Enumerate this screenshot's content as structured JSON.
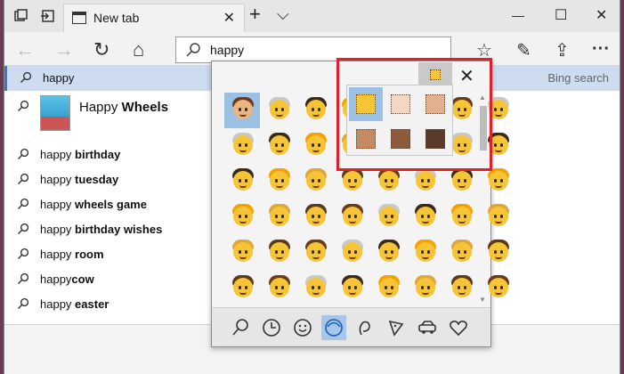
{
  "tab": {
    "title": "New tab",
    "close": "✕",
    "new": "+",
    "menu": "⌵"
  },
  "window_controls": {
    "minimize": "—",
    "maximize": "☐",
    "close": "✕"
  },
  "nav": {
    "back": "←",
    "forward": "→",
    "refresh": "↻",
    "home": "⌂"
  },
  "address": {
    "value": "happy"
  },
  "toolbar_right": {
    "favorite": "☆",
    "pen": "✎",
    "share": "⇪",
    "more": "···"
  },
  "suggestions": {
    "selected": {
      "text": "happy",
      "right": "Bing search"
    },
    "app": {
      "prefix": "Happy ",
      "bold": "Wheels"
    },
    "items": [
      {
        "prefix": "happy ",
        "bold": "birthday"
      },
      {
        "prefix": "happy ",
        "bold": "tuesday"
      },
      {
        "prefix": "happy ",
        "bold": "wheels game"
      },
      {
        "prefix": "happy ",
        "bold": "birthday wishes"
      },
      {
        "prefix": "happy ",
        "bold": "room"
      },
      {
        "prefix": "happy",
        "bold": "cow"
      },
      {
        "prefix": "happy ",
        "bold": "easter"
      }
    ]
  },
  "emoji_panel": {
    "close": "✕",
    "categories": [
      "search-icon",
      "recent-icon",
      "smiley-icon",
      "people-icon",
      "celebration-icon",
      "food-icon",
      "travel-icon",
      "heart-icon"
    ],
    "active_category": "people-icon",
    "rows": [
      [
        "#e9b784",
        "#f6c537",
        "#f6c537",
        "#f6c537",
        "#f6c537",
        "#f6c537",
        "#f6c537",
        "#f6c537"
      ],
      [
        "#f6c537",
        "#f6c537",
        "#f6c537",
        "#f6c537",
        "#f6c537",
        "#f6c537",
        "#f6c537",
        "#f6c537"
      ],
      [
        "#f6c537",
        "#f6c537",
        "#f6c537",
        "#f6c537",
        "#f6c537",
        "#f6c537",
        "#f6c537",
        "#f6c537"
      ],
      [
        "#f6c537",
        "#f6c537",
        "#f6c537",
        "#f6c537",
        "#f6c537",
        "#f6c537",
        "#f6c537",
        "#f6c537"
      ],
      [
        "#f6c537",
        "#f6c537",
        "#f6c537",
        "#f6c537",
        "#f6c537",
        "#f6c537",
        "#f6c537",
        "#f6c537"
      ],
      [
        "#f6c537",
        "#f6c537",
        "#f6c537",
        "#f6c537",
        "#f6c537",
        "#f6c537",
        "#f6c537",
        "#f6c537"
      ]
    ]
  },
  "skin_tones": {
    "active_index": 0,
    "colors": [
      "#f6c537",
      "#f5d6c3",
      "#e3b08d",
      "#c48a63",
      "#8e5a3a",
      "#5a3a2a"
    ]
  },
  "colors": {
    "accent": "#3878d0",
    "highlight": "#e0202a"
  }
}
